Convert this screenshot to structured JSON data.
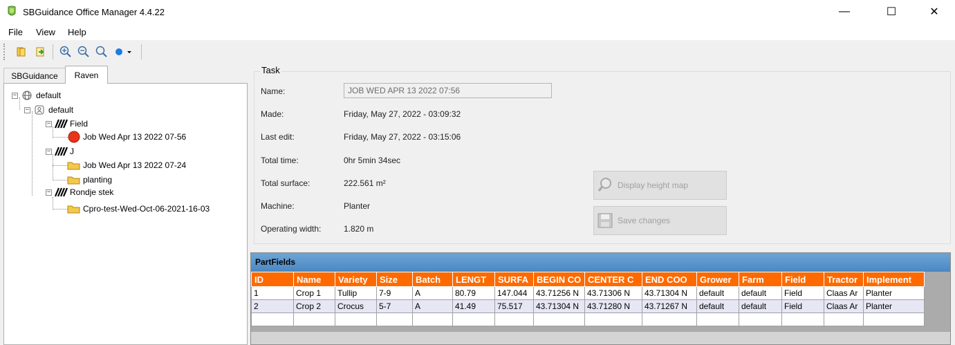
{
  "window": {
    "title": "SBGuidance Office Manager 4.4.22",
    "minimize_glyph": "—",
    "maximize_glyph": "☐",
    "close_glyph": "✕"
  },
  "menu": [
    "File",
    "View",
    "Help"
  ],
  "toolbar": {
    "icons": [
      "open-folder-icon",
      "import-icon",
      "zoom-in-icon",
      "zoom-out-icon",
      "zoom-fit-icon",
      "color-dot-dropdown-icon"
    ]
  },
  "tabs": {
    "items": [
      "SBGuidance",
      "Raven"
    ],
    "active": "Raven"
  },
  "tree": {
    "root": "default",
    "client": "default",
    "fields": [
      {
        "label": "Field",
        "children": [
          "Job Wed Apr 13 2022 07-56"
        ]
      },
      {
        "label": "J",
        "children": [
          "Job Wed Apr 13 2022 07-24",
          "planting"
        ]
      },
      {
        "label": "Rondje stek",
        "children": [
          "Cpro-test-Wed-Oct-06-2021-16-03"
        ]
      }
    ]
  },
  "task": {
    "legend": "Task",
    "name_label": "Name:",
    "name_value": "JOB WED APR 13 2022 07:56",
    "made_label": "Made:",
    "made_value": "Friday, May 27, 2022 - 03:09:32",
    "last_edit_label": "Last edit:",
    "last_edit_value": "Friday, May 27, 2022 - 03:15:06",
    "total_time_label": "Total time:",
    "total_time_value": "0hr 5min 34sec",
    "total_surface_label": "Total surface:",
    "total_surface_value": "222.561 m²",
    "machine_label": "Machine:",
    "machine_value": "Planter",
    "operating_width_label": "Operating width:",
    "operating_width_value": "1.820 m",
    "display_height_map_label": "Display height map",
    "save_changes_label": "Save changes"
  },
  "partfields": {
    "caption": "PartFields",
    "columns": [
      "ID",
      "Name",
      "Variety",
      "Size",
      "Batch",
      "LENGT",
      "SURFA",
      "BEGIN CO",
      "CENTER C",
      "END COO",
      "Grower",
      "Farm",
      "Field",
      "Tractor",
      "Implement"
    ],
    "rows": [
      [
        "1",
        "Crop 1",
        "Tullip",
        "7-9",
        "A",
        "80.79",
        "147.044",
        "43.71256 N",
        "43.71306 N",
        "43.71304 N",
        "default",
        "default",
        "Field",
        "Claas Ar",
        "Planter"
      ],
      [
        "2",
        "Crop 2",
        "Crocus",
        "5-7",
        "A",
        "41.49",
        "75.517",
        "43.71304 N",
        "43.71280 N",
        "43.71267 N",
        "default",
        "default",
        "Field",
        "Claas Ar",
        "Planter"
      ]
    ]
  },
  "colors": {
    "grid_header": "#ff6a00",
    "grid_caption": "#5b96cc",
    "job_active_dot": "#e8341c",
    "folder": "#f2c94c"
  }
}
